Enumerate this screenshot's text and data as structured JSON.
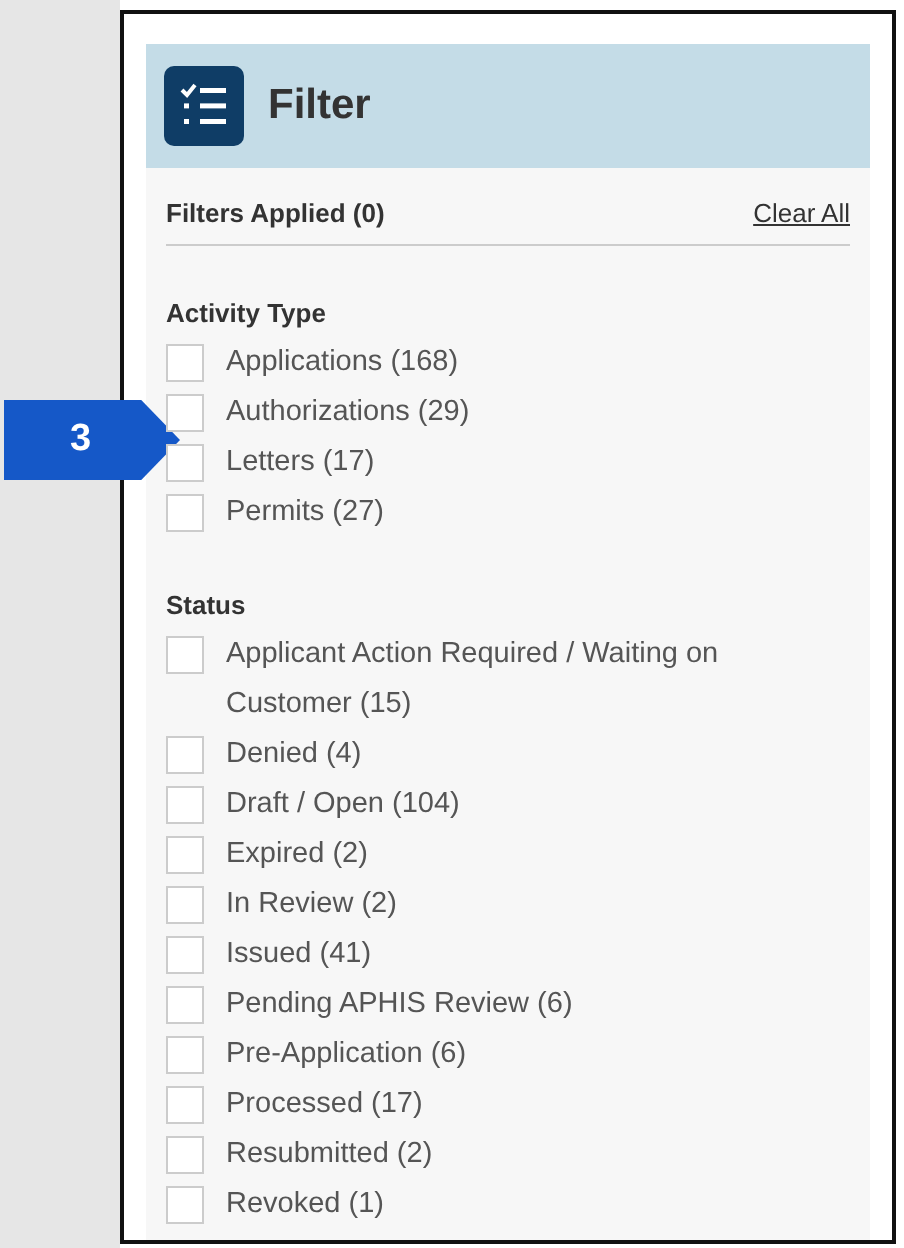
{
  "callout": {
    "label": "3"
  },
  "header": {
    "title": "Filter"
  },
  "summary": {
    "label": "Filters Applied (0)",
    "clear_link": "Clear All"
  },
  "groups": [
    {
      "title": "Activity Type",
      "options": [
        {
          "label": "Applications (168)",
          "checked": false
        },
        {
          "label": "Authorizations (29)",
          "checked": false
        },
        {
          "label": "Letters (17)",
          "checked": false
        },
        {
          "label": "Permits (27)",
          "checked": false
        }
      ]
    },
    {
      "title": "Status",
      "options": [
        {
          "label": "Applicant Action Required / Waiting on Customer (15)",
          "checked": false
        },
        {
          "label": "Denied (4)",
          "checked": false
        },
        {
          "label": "Draft / Open (104)",
          "checked": false
        },
        {
          "label": "Expired (2)",
          "checked": false
        },
        {
          "label": "In Review (2)",
          "checked": false
        },
        {
          "label": "Issued (41)",
          "checked": false
        },
        {
          "label": "Pending APHIS Review (6)",
          "checked": false
        },
        {
          "label": "Pre-Application (6)",
          "checked": false
        },
        {
          "label": "Processed (17)",
          "checked": false
        },
        {
          "label": "Resubmitted (2)",
          "checked": false
        },
        {
          "label": "Revoked (1)",
          "checked": false
        }
      ]
    }
  ]
}
